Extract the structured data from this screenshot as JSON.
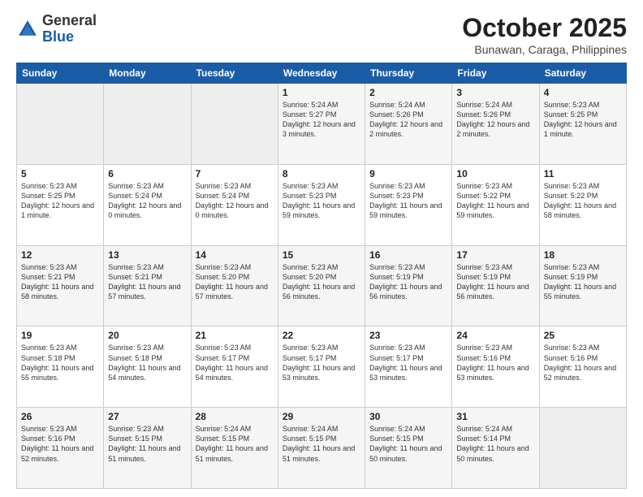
{
  "header": {
    "logo_general": "General",
    "logo_blue": "Blue",
    "month": "October 2025",
    "location": "Bunawan, Caraga, Philippines"
  },
  "weekdays": [
    "Sunday",
    "Monday",
    "Tuesday",
    "Wednesday",
    "Thursday",
    "Friday",
    "Saturday"
  ],
  "weeks": [
    [
      {
        "day": "",
        "content": ""
      },
      {
        "day": "",
        "content": ""
      },
      {
        "day": "",
        "content": ""
      },
      {
        "day": "1",
        "content": "Sunrise: 5:24 AM\nSunset: 5:27 PM\nDaylight: 12 hours and 3 minutes."
      },
      {
        "day": "2",
        "content": "Sunrise: 5:24 AM\nSunset: 5:26 PM\nDaylight: 12 hours and 2 minutes."
      },
      {
        "day": "3",
        "content": "Sunrise: 5:24 AM\nSunset: 5:26 PM\nDaylight: 12 hours and 2 minutes."
      },
      {
        "day": "4",
        "content": "Sunrise: 5:23 AM\nSunset: 5:25 PM\nDaylight: 12 hours and 1 minute."
      }
    ],
    [
      {
        "day": "5",
        "content": "Sunrise: 5:23 AM\nSunset: 5:25 PM\nDaylight: 12 hours and 1 minute."
      },
      {
        "day": "6",
        "content": "Sunrise: 5:23 AM\nSunset: 5:24 PM\nDaylight: 12 hours and 0 minutes."
      },
      {
        "day": "7",
        "content": "Sunrise: 5:23 AM\nSunset: 5:24 PM\nDaylight: 12 hours and 0 minutes."
      },
      {
        "day": "8",
        "content": "Sunrise: 5:23 AM\nSunset: 5:23 PM\nDaylight: 11 hours and 59 minutes."
      },
      {
        "day": "9",
        "content": "Sunrise: 5:23 AM\nSunset: 5:23 PM\nDaylight: 11 hours and 59 minutes."
      },
      {
        "day": "10",
        "content": "Sunrise: 5:23 AM\nSunset: 5:22 PM\nDaylight: 11 hours and 59 minutes."
      },
      {
        "day": "11",
        "content": "Sunrise: 5:23 AM\nSunset: 5:22 PM\nDaylight: 11 hours and 58 minutes."
      }
    ],
    [
      {
        "day": "12",
        "content": "Sunrise: 5:23 AM\nSunset: 5:21 PM\nDaylight: 11 hours and 58 minutes."
      },
      {
        "day": "13",
        "content": "Sunrise: 5:23 AM\nSunset: 5:21 PM\nDaylight: 11 hours and 57 minutes."
      },
      {
        "day": "14",
        "content": "Sunrise: 5:23 AM\nSunset: 5:20 PM\nDaylight: 11 hours and 57 minutes."
      },
      {
        "day": "15",
        "content": "Sunrise: 5:23 AM\nSunset: 5:20 PM\nDaylight: 11 hours and 56 minutes."
      },
      {
        "day": "16",
        "content": "Sunrise: 5:23 AM\nSunset: 5:19 PM\nDaylight: 11 hours and 56 minutes."
      },
      {
        "day": "17",
        "content": "Sunrise: 5:23 AM\nSunset: 5:19 PM\nDaylight: 11 hours and 56 minutes."
      },
      {
        "day": "18",
        "content": "Sunrise: 5:23 AM\nSunset: 5:19 PM\nDaylight: 11 hours and 55 minutes."
      }
    ],
    [
      {
        "day": "19",
        "content": "Sunrise: 5:23 AM\nSunset: 5:18 PM\nDaylight: 11 hours and 55 minutes."
      },
      {
        "day": "20",
        "content": "Sunrise: 5:23 AM\nSunset: 5:18 PM\nDaylight: 11 hours and 54 minutes."
      },
      {
        "day": "21",
        "content": "Sunrise: 5:23 AM\nSunset: 5:17 PM\nDaylight: 11 hours and 54 minutes."
      },
      {
        "day": "22",
        "content": "Sunrise: 5:23 AM\nSunset: 5:17 PM\nDaylight: 11 hours and 53 minutes."
      },
      {
        "day": "23",
        "content": "Sunrise: 5:23 AM\nSunset: 5:17 PM\nDaylight: 11 hours and 53 minutes."
      },
      {
        "day": "24",
        "content": "Sunrise: 5:23 AM\nSunset: 5:16 PM\nDaylight: 11 hours and 53 minutes."
      },
      {
        "day": "25",
        "content": "Sunrise: 5:23 AM\nSunset: 5:16 PM\nDaylight: 11 hours and 52 minutes."
      }
    ],
    [
      {
        "day": "26",
        "content": "Sunrise: 5:23 AM\nSunset: 5:16 PM\nDaylight: 11 hours and 52 minutes."
      },
      {
        "day": "27",
        "content": "Sunrise: 5:23 AM\nSunset: 5:15 PM\nDaylight: 11 hours and 51 minutes."
      },
      {
        "day": "28",
        "content": "Sunrise: 5:24 AM\nSunset: 5:15 PM\nDaylight: 11 hours and 51 minutes."
      },
      {
        "day": "29",
        "content": "Sunrise: 5:24 AM\nSunset: 5:15 PM\nDaylight: 11 hours and 51 minutes."
      },
      {
        "day": "30",
        "content": "Sunrise: 5:24 AM\nSunset: 5:15 PM\nDaylight: 11 hours and 50 minutes."
      },
      {
        "day": "31",
        "content": "Sunrise: 5:24 AM\nSunset: 5:14 PM\nDaylight: 11 hours and 50 minutes."
      },
      {
        "day": "",
        "content": ""
      }
    ]
  ]
}
